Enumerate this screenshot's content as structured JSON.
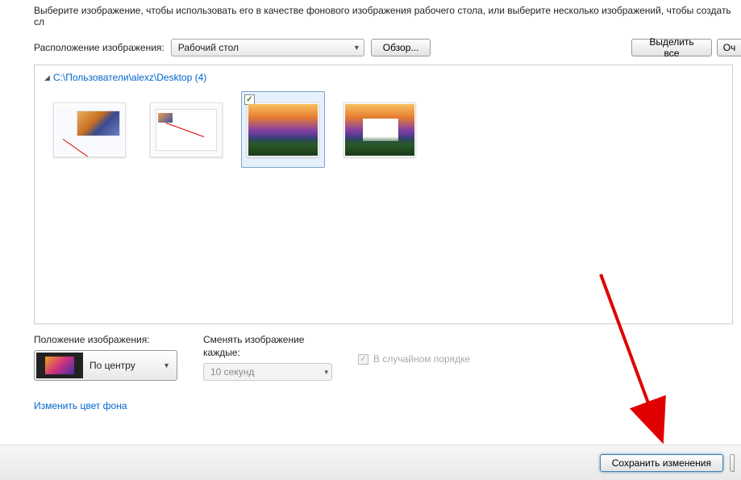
{
  "instruction": "Выберите изображение, чтобы использовать его в качестве фонового изображения рабочего стола, или выберите несколько изображений, чтобы создать сл",
  "location_label": "Расположение изображения:",
  "location_value": "Рабочий стол",
  "browse_label": "Обзор...",
  "select_all_label": "Выделить все",
  "clear_label": "Оч",
  "folder_path": "C:\\Пользователи\\alexz\\Desktop (4)",
  "position": {
    "label": "Положение изображения:",
    "value": "По центру"
  },
  "interval": {
    "label_line1": "Сменять изображение",
    "label_line2": "каждые:",
    "value": "10 секунд"
  },
  "shuffle_label": "В случайном порядке",
  "change_color_link": "Изменить цвет фона",
  "save_button": "Сохранить изменения"
}
